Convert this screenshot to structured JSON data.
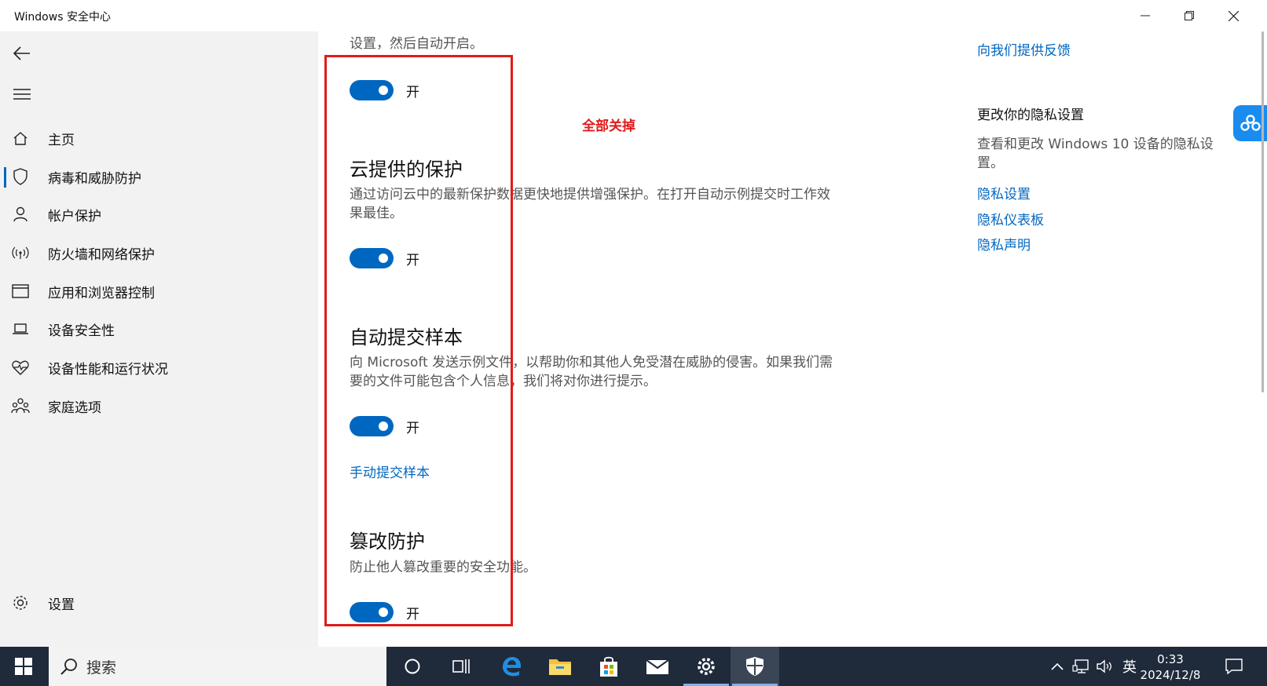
{
  "window": {
    "title": "Windows 安全中心"
  },
  "sidebar": {
    "items": [
      {
        "label": "主页",
        "icon": "home-icon"
      },
      {
        "label": "病毒和威胁防护",
        "icon": "shield-icon",
        "active": true
      },
      {
        "label": "帐户保护",
        "icon": "person-icon"
      },
      {
        "label": "防火墙和网络保护",
        "icon": "wireless-icon"
      },
      {
        "label": "应用和浏览器控制",
        "icon": "browser-window-icon"
      },
      {
        "label": "设备安全性",
        "icon": "laptop-icon"
      },
      {
        "label": "设备性能和运行状况",
        "icon": "heart-pulse-icon"
      },
      {
        "label": "家庭选项",
        "icon": "family-icon"
      }
    ],
    "settings_label": "设置"
  },
  "main": {
    "cut_text": "设置，然后自动开启。",
    "annotation": "全部关掉",
    "toggle_on_label": "开",
    "sections": [
      {
        "title": "云提供的保护",
        "description": "通过访问云中的最新保护数据更快地提供增强保护。在打开自动示例提交时工作效果最佳。"
      },
      {
        "title": "自动提交样本",
        "description": "向 Microsoft 发送示例文件，以帮助你和其他人免受潜在威胁的侵害。如果我们需要的文件可能包含个人信息，我们将对你进行提示。",
        "link": "手动提交样本"
      },
      {
        "title": "篡改防护",
        "description": "防止他人篡改重要的安全功能。"
      }
    ]
  },
  "right": {
    "feedback_link": "向我们提供反馈",
    "privacy_heading": "更改你的隐私设置",
    "privacy_text": "查看和更改 Windows 10 设备的隐私设置。",
    "links": [
      "隐私设置",
      "隐私仪表板",
      "隐私声明"
    ]
  },
  "taskbar": {
    "search_placeholder": "搜索",
    "ime_label": "英",
    "time": "0:33",
    "date": "2024/12/8"
  },
  "colors": {
    "accent": "#0067c0",
    "annotation_red": "#e21a1a",
    "taskbar": "#1f2a3b"
  }
}
